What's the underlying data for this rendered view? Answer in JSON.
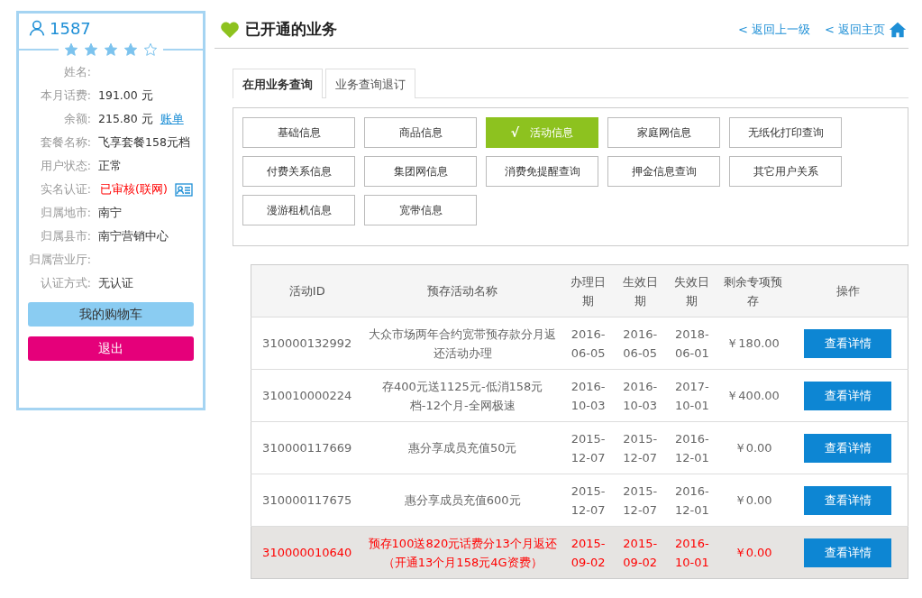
{
  "profile": {
    "phone": "1587",
    "stars": 4,
    "fields": [
      {
        "label": "姓名:"
      },
      {
        "label": "本月话费:",
        "value": "191.00 元"
      },
      {
        "label": "余额:",
        "value": "215.80 元",
        "link": "账单"
      },
      {
        "label": "套餐名称:",
        "value": "飞享套餐158元档"
      },
      {
        "label": "用户状态:",
        "value": "正常"
      },
      {
        "label": "实名认证:",
        "value": "已审核(联网)",
        "alert": true,
        "card_icon": true
      },
      {
        "label": "归属地市:",
        "value": "南宁"
      },
      {
        "label": "归属县市:",
        "value": "南宁营销中心"
      },
      {
        "label": "归属营业厅:"
      },
      {
        "label": "认证方式:",
        "value": "无认证"
      }
    ],
    "cart_button": "我的购物车",
    "logout_button": "退出"
  },
  "header": {
    "title": "已开通的业务",
    "links": [
      "< 返回上一级",
      "< 返回主页"
    ]
  },
  "tabs": [
    {
      "label": "在用业务查询",
      "selected": true
    },
    {
      "label": "业务查询退订",
      "selected": false
    }
  ],
  "categories": [
    {
      "label": "基础信息",
      "selected": false
    },
    {
      "label": "商品信息",
      "selected": false
    },
    {
      "label": "活动信息",
      "selected": true,
      "check": "√"
    },
    {
      "label": "家庭网信息",
      "selected": false
    },
    {
      "label": "无纸化打印查询",
      "selected": false
    },
    {
      "label": "付费关系信息",
      "selected": false
    },
    {
      "label": "集团网信息",
      "selected": false
    },
    {
      "label": "消费免提醒查询",
      "selected": false
    },
    {
      "label": "押金信息查询",
      "selected": false
    },
    {
      "label": "其它用户关系",
      "selected": false
    },
    {
      "label": "漫游租机信息",
      "selected": false
    },
    {
      "label": "宽带信息",
      "selected": false
    }
  ],
  "table": {
    "columns": [
      "活动ID",
      "预存活动名称",
      "办理日期",
      "生效日期",
      "失效日期",
      "剩余专项预存",
      "操作"
    ],
    "rows": [
      {
        "id": "310000132992",
        "name": "大众市场两年合约宽带预存款分月返还活动办理",
        "start": "2016-06-05",
        "effective": "2016-06-05",
        "expire": "2018-06-01",
        "balance": "￥180.00",
        "action": "查看详情",
        "highlighted": false
      },
      {
        "id": "310010000224",
        "name": "存400元送1125元-低消158元档-12个月-全网极速",
        "start": "2016-10-03",
        "effective": "2016-10-03",
        "expire": "2017-10-01",
        "balance": "￥400.00",
        "action": "查看详情",
        "highlighted": false
      },
      {
        "id": "310000117669",
        "name": "惠分享成员充值50元",
        "start": "2015-12-07",
        "effective": "2015-12-07",
        "expire": "2016-12-01",
        "balance": "￥0.00",
        "action": "查看详情",
        "highlighted": false
      },
      {
        "id": "310000117675",
        "name": "惠分享成员充值600元",
        "start": "2015-12-07",
        "effective": "2015-12-07",
        "expire": "2016-12-01",
        "balance": "￥0.00",
        "action": "查看详情",
        "highlighted": false
      },
      {
        "id": "310000010640",
        "name": "预存100送820元话费分13个月返还（开通13个月158元4G资费）",
        "start": "2015-09-02",
        "effective": "2015-09-02",
        "expire": "2016-10-01",
        "balance": "￥0.00",
        "action": "查看详情",
        "highlighted": true
      }
    ]
  }
}
